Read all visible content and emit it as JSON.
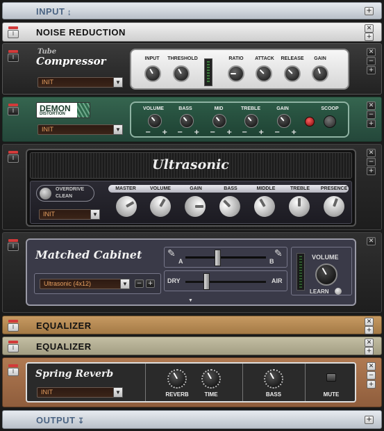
{
  "input": {
    "label": "INPUT"
  },
  "output": {
    "label": "OUTPUT"
  },
  "noise": {
    "title": "NOISE REDUCTION"
  },
  "compressor": {
    "brand_top": "Tube",
    "brand_main": "Compressor",
    "preset": "INIT",
    "knobs": [
      "INPUT",
      "THRESHOLD",
      "RATIO",
      "ATTACK",
      "RELEASE",
      "GAIN"
    ]
  },
  "demon": {
    "brand_main": "DEMON",
    "brand_sub": "DISTORTION",
    "preset": "INIT",
    "knobs": [
      "VOLUME",
      "BASS",
      "MID",
      "TREBLE",
      "GAIN"
    ],
    "scoop": "SCOOP"
  },
  "ultrasonic": {
    "title": "Ultrasonic",
    "overdrive": "OVERDRIVE",
    "clean": "CLEAN",
    "preset": "INIT",
    "knobs": [
      "MASTER",
      "VOLUME",
      "GAIN",
      "BASS",
      "MIDDLE",
      "TREBLE",
      "PRESENCE"
    ]
  },
  "cabinet": {
    "title": "Matched Cabinet",
    "model": "Ultrasonic (4x12)",
    "a": "A",
    "b": "B",
    "dry": "DRY",
    "air": "AIR",
    "volume": "VOLUME",
    "learn": "LEARN"
  },
  "eq1": {
    "title": "EQUALIZER"
  },
  "eq2": {
    "title": "EQUALIZER"
  },
  "reverb": {
    "title": "Spring Reverb",
    "preset": "INIT",
    "reverb": "REVERB",
    "time": "TIME",
    "bass": "BASS",
    "mute": "MUTE"
  },
  "icons": {
    "arrow": "down-arrow-icon",
    "plus": "plus-icon",
    "close": "close-icon",
    "minus": "minus-icon"
  },
  "colors": {
    "demon_green": "#2f5a4a",
    "eq1": "#b48a55",
    "eq2": "#b3ae93",
    "reverb": "#a06d4a",
    "io": "#dfe4ea"
  }
}
